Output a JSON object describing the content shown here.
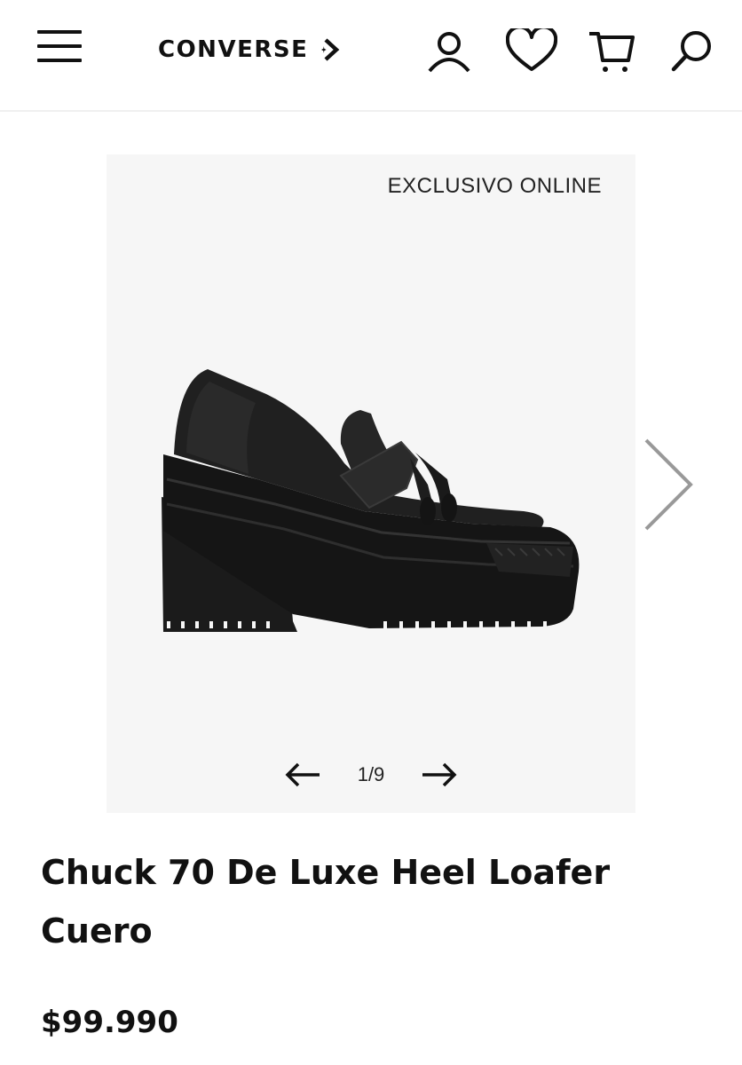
{
  "header": {
    "logo_text": "CONVERSE",
    "icons": [
      "menu-icon",
      "account-icon",
      "wishlist-heart-icon",
      "cart-icon",
      "search-icon"
    ]
  },
  "gallery": {
    "badge": "EXCLUSIVO ONLINE",
    "counter": "1/9",
    "current_image": 1,
    "total_images": 9
  },
  "product": {
    "title_line1": "Chuck 70 De Luxe Heel Loafer",
    "title_line2": "Cuero",
    "price": "$99.990"
  },
  "colors": {
    "text": "#111111",
    "gallery_bg": "#f6f6f6",
    "header_border": "#f0f0f0",
    "carousel_arrow": "#999999",
    "shoe": "#1b1b1b"
  }
}
